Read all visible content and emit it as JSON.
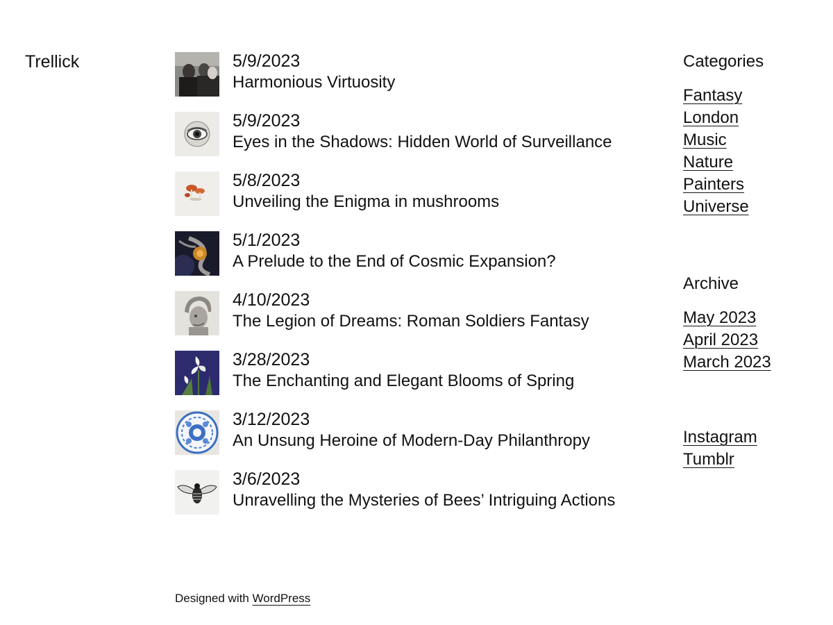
{
  "site": {
    "title": "Trellick"
  },
  "posts": [
    {
      "date": "5/9/2023",
      "title": "Harmonious Virtuosity",
      "image": "photo-people-thumbnail"
    },
    {
      "date": "5/9/2023",
      "title": "Eyes in the Shadows: Hidden World of Surveillance",
      "image": "eye-engraving-thumbnail"
    },
    {
      "date": "5/8/2023",
      "title": "Unveiling the Enigma in mushrooms",
      "image": "mushroom-illustration-thumbnail"
    },
    {
      "date": "5/1/2023",
      "title": "A Prelude to the End of Cosmic Expansion?",
      "image": "cosmic-swirl-thumbnail"
    },
    {
      "date": "4/10/2023",
      "title": "The Legion of Dreams: Roman Soldiers Fantasy",
      "image": "roman-helmet-statue-thumbnail"
    },
    {
      "date": "3/28/2023",
      "title": "The Enchanting and Elegant Blooms of Spring",
      "image": "iris-flowers-thumbnail"
    },
    {
      "date": "3/12/2023",
      "title": "An Unsung Heroine of Modern-Day Philanthropy",
      "image": "blue-porcelain-plate-thumbnail"
    },
    {
      "date": "3/6/2023",
      "title": "Unravelling the Mysteries of Bees’ Intriguing Actions",
      "image": "bee-engraving-thumbnail"
    }
  ],
  "sidebar": {
    "categories": {
      "title": "Categories",
      "items": [
        "Fantasy",
        "London",
        "Music",
        "Nature",
        "Painters",
        "Universe"
      ]
    },
    "archive": {
      "title": "Archive",
      "items": [
        "May 2023",
        "April 2023",
        "March 2023"
      ]
    },
    "social": {
      "items": [
        "Instagram",
        "Tumblr"
      ]
    }
  },
  "footer": {
    "prefix": "Designed with",
    "link": "WordPress"
  }
}
